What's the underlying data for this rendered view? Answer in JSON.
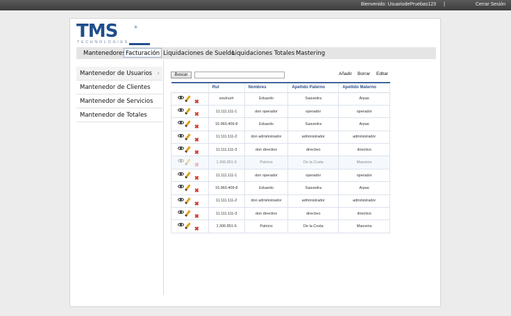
{
  "topbar": {
    "welcome": "Bienvenido: UsuariodePruebas123",
    "separator": "|",
    "logout": "Cerrar Sesión"
  },
  "logo": {
    "brand": "TMS",
    "tagline": "TECHNOLOGIES",
    "registered": "®"
  },
  "menu": {
    "items": [
      "Mantenedores",
      "Facturación",
      "Liquidaciones de Sueldo",
      "Liquidaciones Totales",
      "Mastering"
    ],
    "active": "Facturación"
  },
  "sidenav": {
    "items": [
      "Mantenedor de Usuarios",
      "Mantenedor de Clientes",
      "Mantenedor de Servicios",
      "Mantenedor de Totales"
    ],
    "chevron": "›"
  },
  "toolbar": {
    "search_button": "Buscar",
    "search_value": "",
    "add": "Añadir",
    "delete": "Borrar",
    "edit": "Editar"
  },
  "table": {
    "headers": [
      "",
      "Rut",
      "Nombres",
      "Apellido Paterno",
      "Apellido Materno"
    ],
    "rows": [
      [
        "soulrush",
        "Eduardo",
        "Saavedra",
        "Arpas"
      ],
      [
        "11.111.111-1",
        "don operador",
        "operador",
        "operador"
      ],
      [
        "15.960.409-8",
        "Eduardo",
        "Saavedra",
        "Arpas"
      ],
      [
        "11.111.111-2",
        "don administrador",
        "administrador",
        "administrador"
      ],
      [
        "11.111.111-3",
        "don directivo",
        "directivo",
        "directivo"
      ],
      [
        "1.306.851-6",
        "Patricio",
        "De la Costa",
        "Maureira"
      ],
      [
        "11.111.111-1",
        "don operador",
        "operador",
        "operador"
      ],
      [
        "15.960.409-8",
        "Eduardo",
        "Saavedra",
        "Arpas"
      ],
      [
        "11.111.111-2",
        "don administrador",
        "administrador",
        "administrador"
      ],
      [
        "11.111.111-3",
        "don directivo",
        "directivo",
        "directivo"
      ],
      [
        "1.306.851-6",
        "Patricio",
        "De la Costa",
        "Maureira"
      ]
    ],
    "row_icons": [
      "eye-icon",
      "pencil-icon",
      "close-icon"
    ],
    "delete_glyph": "✖"
  },
  "colors": {
    "brand": "#1f4e8c",
    "header_text": "#2b4f86",
    "delete": "#d23a2a"
  }
}
